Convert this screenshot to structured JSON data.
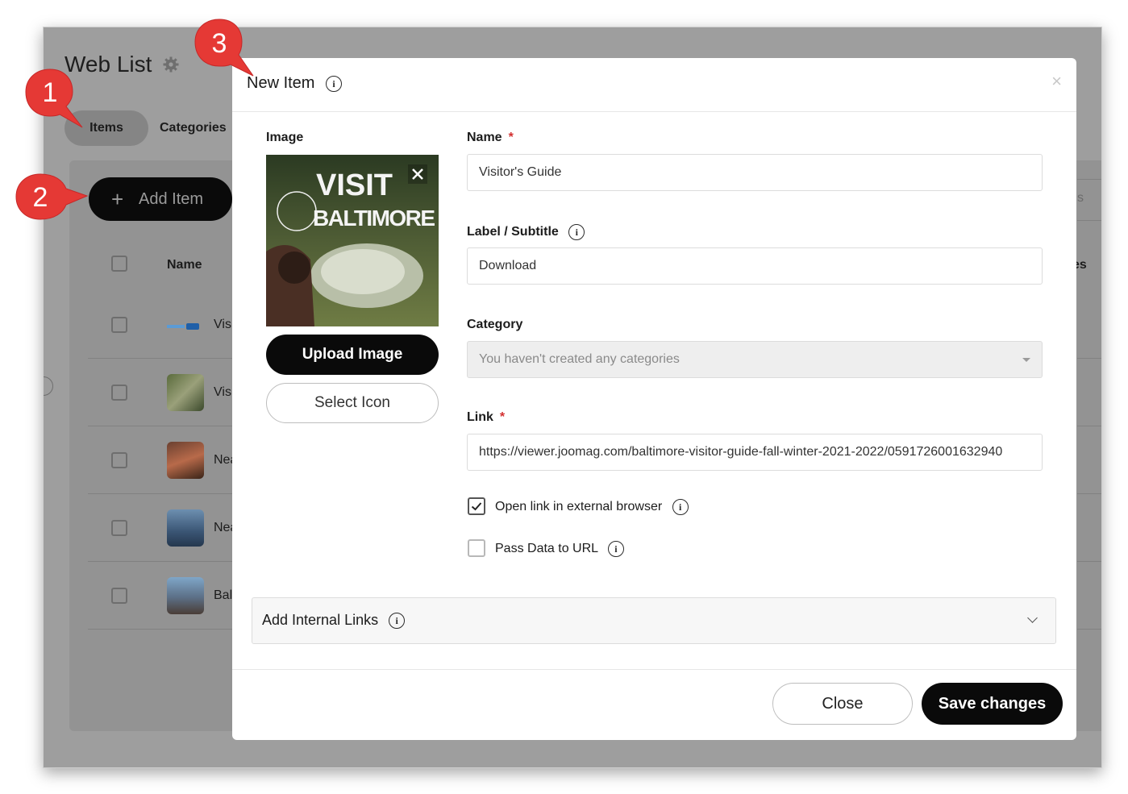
{
  "background": {
    "title": "Web List",
    "tabs": [
      "Items",
      "Categories"
    ],
    "add_button": "Add Item",
    "table_header": {
      "name": "Name"
    },
    "rows": [
      "Vis",
      "Vis",
      "Nea",
      "Nea",
      "Bal"
    ],
    "right_fragment_1": "s",
    "right_fragment_2": "es"
  },
  "modal": {
    "title": "New Item",
    "close_glyph": "×",
    "image_label": "Image",
    "upload_button": "Upload Image",
    "select_icon_button": "Select Icon",
    "name_label": "Name",
    "name_value": "Visitor's Guide",
    "subtitle_label": "Label / Subtitle",
    "subtitle_value": "Download",
    "category_label": "Category",
    "category_placeholder": "You haven't created any categories",
    "link_label": "Link",
    "link_value": "https://viewer.joomag.com/baltimore-visitor-guide-fall-winter-2021-2022/0591726001632940",
    "required_mark": "*",
    "open_external_label": "Open link in external browser",
    "open_external_checked": true,
    "pass_data_label": "Pass Data to URL",
    "pass_data_checked": false,
    "internal_links_label": "Add Internal Links",
    "footer_close": "Close",
    "footer_save": "Save changes"
  },
  "thumbnail_text": {
    "line1": "VISIT",
    "line2": "BALTIMORE"
  },
  "callouts": [
    "1",
    "2",
    "3"
  ],
  "colors": {
    "accent": "#0a0a0a",
    "callout": "#e53935",
    "required": "#d32f2f"
  },
  "icons": [
    "gear-icon",
    "plus-icon",
    "info-icon",
    "close-icon",
    "check-icon",
    "chevron-down-icon"
  ]
}
